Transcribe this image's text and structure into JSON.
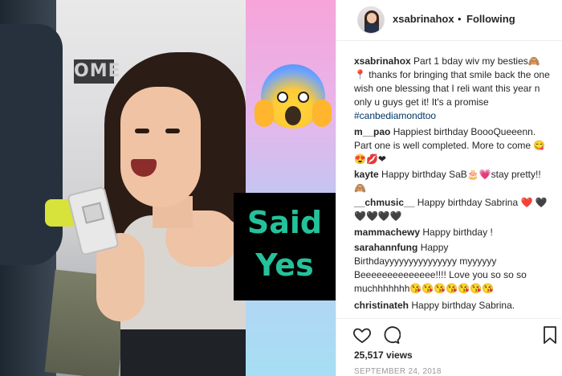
{
  "post": {
    "username": "xsabrinahox",
    "separator": "•",
    "follow_status": "Following"
  },
  "media": {
    "sign_text": "OME",
    "overlay_text_1": "Said",
    "overlay_text_2": "Yes",
    "emoji": "face-screaming-in-fear"
  },
  "caption": {
    "username": "xsabrinahox",
    "text": "Part 1 bday wiv my besties🙈📍 thanks for bringing that smile back the one wish one blessing that I reli want this year n only u guys get it! It's a promise",
    "hashtag": "#canbediamondtoo"
  },
  "comments": [
    {
      "username": "m__pao",
      "text": "Happiest birthday BoooQueeenn. Part one is well completed. More to come 😋😍💋❤"
    },
    {
      "username": "kayte",
      "text": "Happy birthday SaB🎂💗stay pretty!!🙈"
    },
    {
      "username": "__chmusic__",
      "text": "Happy birthday Sabrina ❤️ 🖤🖤🖤🖤🖤"
    },
    {
      "username": "mammachewy",
      "text": "Happy birthday !"
    },
    {
      "username": "sarahannfung",
      "text": "Happy Birthdayyyyyyyyyyyyyyy myyyyyy Beeeeeeeeeeeeee!!!! Love you so so so muchhhhhhh😘😘😘😘😘😘😘"
    },
    {
      "username": "christinateh",
      "text": "Happy birthday Sabrina."
    }
  ],
  "stats": {
    "views": "25,517 views",
    "date": "SEPTEMBER 24, 2018"
  },
  "icons": {
    "like": "heart-icon",
    "comment": "comment-icon",
    "save": "bookmark-icon"
  }
}
